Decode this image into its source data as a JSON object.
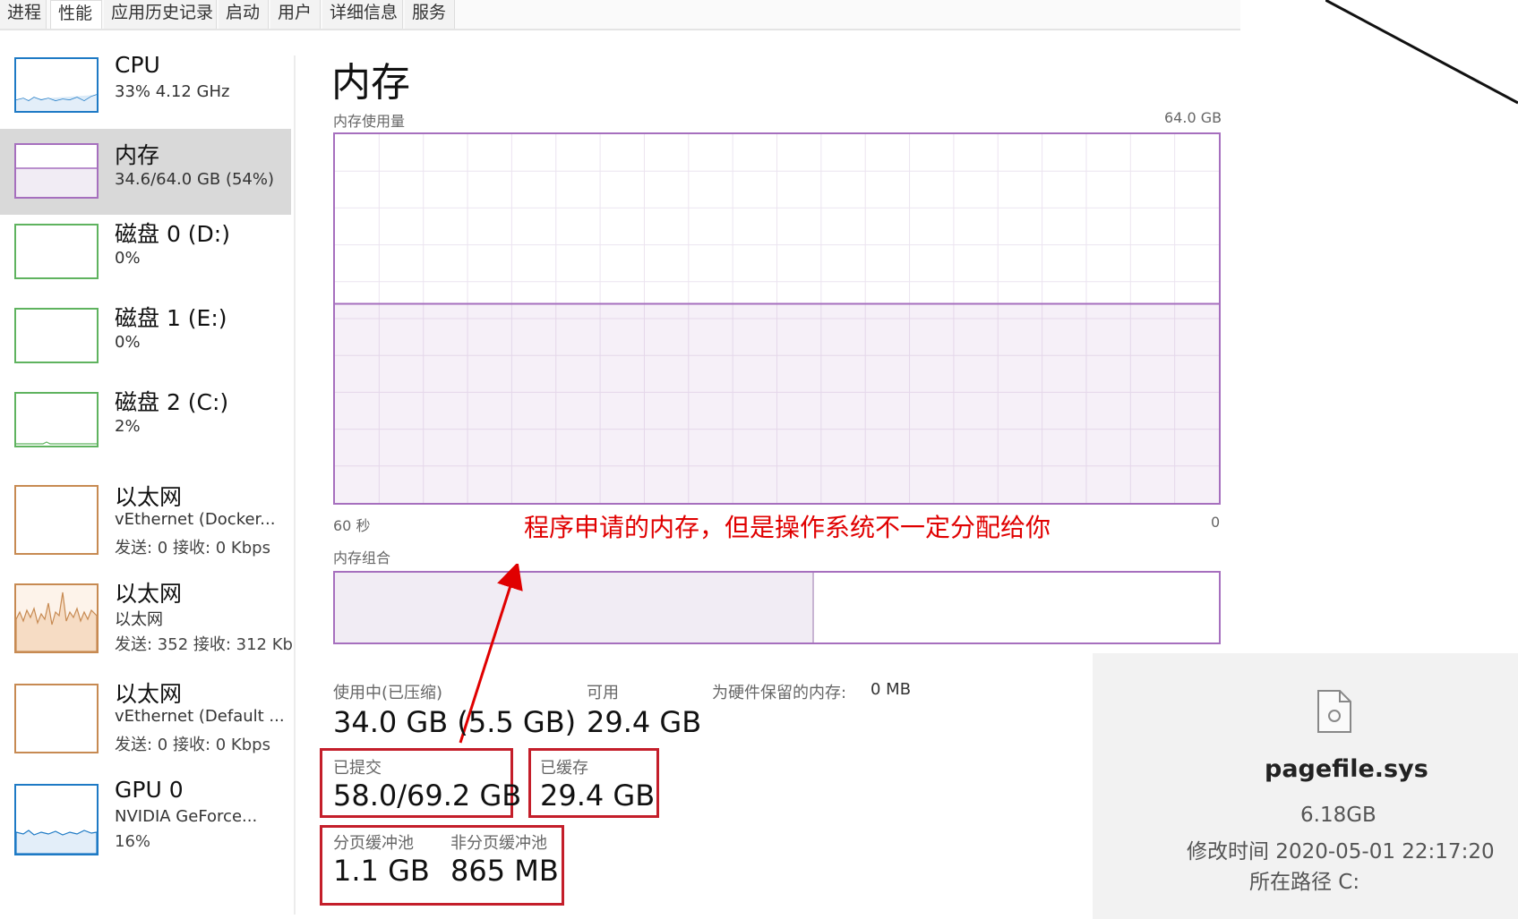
{
  "tabs": [
    "进程",
    "性能",
    "应用历史记录",
    "启动",
    "用户",
    "详细信息",
    "服务"
  ],
  "active_tab": "性能",
  "sidebar": {
    "items": [
      {
        "title": "CPU",
        "sub": "33% 4.12 GHz",
        "sub2": "",
        "color": "#1e7ac5",
        "kind": "cpu"
      },
      {
        "title": "内存",
        "sub": "34.6/64.0 GB (54%)",
        "sub2": "",
        "color": "#a66fbe",
        "kind": "mem"
      },
      {
        "title": "磁盘 0 (D:)",
        "sub": "0%",
        "sub2": "",
        "color": "#5fb35f",
        "kind": "disk"
      },
      {
        "title": "磁盘 1 (E:)",
        "sub": "0%",
        "sub2": "",
        "color": "#5fb35f",
        "kind": "disk"
      },
      {
        "title": "磁盘 2 (C:)",
        "sub": "2%",
        "sub2": "",
        "color": "#5fb35f",
        "kind": "disk"
      },
      {
        "title": "以太网",
        "sub": "vEthernet (Docker...",
        "sub2": "发送: 0 接收: 0 Kbps",
        "color": "#c78a52",
        "kind": "net"
      },
      {
        "title": "以太网",
        "sub": "以太网",
        "sub2": "发送: 352 接收: 312 Kb",
        "color": "#c78a52",
        "kind": "net-active"
      },
      {
        "title": "以太网",
        "sub": "vEthernet (Default ...",
        "sub2": "发送: 0 接收: 0 Kbps",
        "color": "#c78a52",
        "kind": "net"
      },
      {
        "title": "GPU 0",
        "sub": "NVIDIA GeForce...",
        "sub2": "16%",
        "color": "#1e7ac5",
        "kind": "gpu"
      }
    ]
  },
  "main": {
    "title": "内存",
    "usage_label": "内存使用量",
    "usage_max": "64.0 GB",
    "time_left": "60 秒",
    "time_right": "0",
    "composition_label": "内存组合",
    "usage_fraction": 0.54,
    "composition_used_fraction": 0.54
  },
  "stats": {
    "in_use_label": "使用中(已压缩)",
    "in_use_value": "34.0 GB (5.5 GB)",
    "available_label": "可用",
    "available_value": "29.4 GB",
    "reserved_label": "为硬件保留的内存:",
    "reserved_value": "0 MB",
    "committed_label": "已提交",
    "committed_value": "58.0/69.2 GB",
    "cached_label": "已缓存",
    "cached_value": "29.4 GB",
    "paged_label": "分页缓冲池",
    "paged_value": "1.1 GB",
    "nonpaged_label": "非分页缓冲池",
    "nonpaged_value": "865 MB"
  },
  "annotation": "程序申请的内存，但是操作系统不一定分配给你",
  "file": {
    "name": "pagefile.sys",
    "size": "6.18GB",
    "modified": "修改时间 2020-05-01 22:17:20",
    "path": "所在路径 C:"
  },
  "colors": {
    "accent_mem": "#a66fbe",
    "annotation_red": "#e00000",
    "highlight_box": "#c41e2a"
  }
}
